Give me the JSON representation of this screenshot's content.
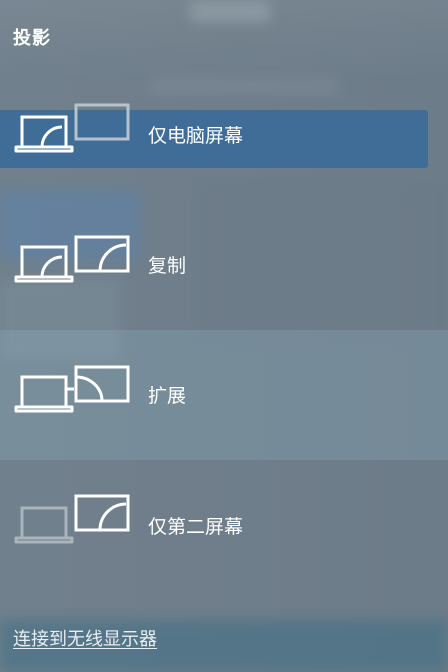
{
  "panel": {
    "title": "投影"
  },
  "options": [
    {
      "label": "仅电脑屏幕",
      "icon": "pc-screen-only-icon",
      "selected": true
    },
    {
      "label": "复制",
      "icon": "duplicate-icon",
      "selected": false
    },
    {
      "label": "扩展",
      "icon": "extend-icon",
      "selected": false
    },
    {
      "label": "仅第二屏幕",
      "icon": "second-screen-only-icon",
      "selected": false
    }
  ],
  "footer": {
    "connect_link": "连接到无线显示器"
  },
  "colors": {
    "selected_background": "#3f6d98",
    "text": "#ffffff",
    "dimmed_icon": "#b7bfc5"
  }
}
